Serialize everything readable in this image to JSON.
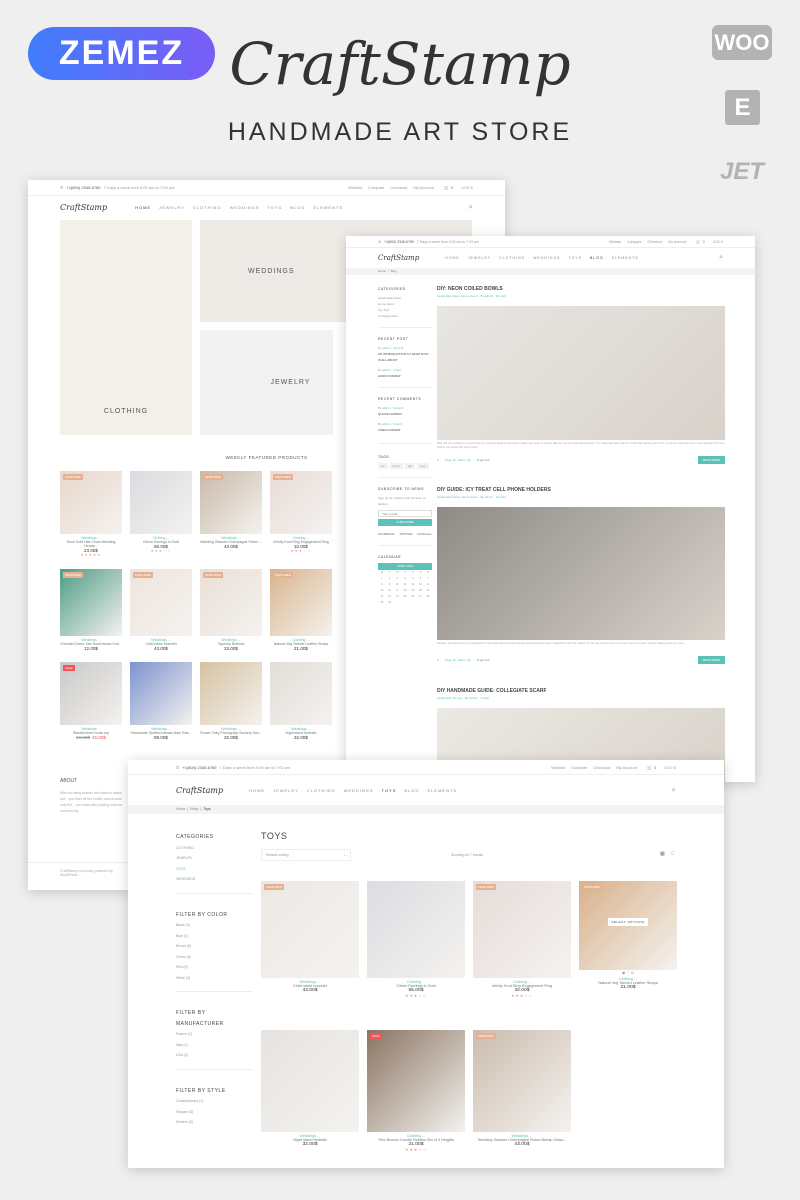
{
  "promo": {
    "vendor": "ZEMEZ",
    "title": "CraftStamp",
    "tagline": "HANDMADE ART STORE",
    "badges": [
      "WOO",
      "E",
      "JET"
    ]
  },
  "store": {
    "logo": "CraftStamp",
    "phone": "+1(800) 2345-6789",
    "hours": "7 Days a week from 9:00 am to 7:00 pm",
    "top_links": [
      "Wishlist",
      "Compare",
      "Checkout",
      "My Account"
    ],
    "cart_count": "0",
    "currency": "USD $",
    "menu": [
      "HOME",
      "JEWELRY",
      "CLOTHING",
      "WEDDINGS",
      "TOYS",
      "BLOG",
      "ELEMENTS"
    ]
  },
  "home": {
    "active_menu": "HOME",
    "banners": [
      "CLOTHING",
      "WEDDINGS",
      "JEWELRY"
    ],
    "featured_title": "WEEKLY FEATURED PRODUCTS",
    "products": [
      {
        "badge": "FEATURED",
        "cat": "Weddings ...",
        "name": "Rose Gold Hair Chain Wedding Headp...",
        "price": "23.00$",
        "stars": "★★★★★",
        "color": "#e9d7cc"
      },
      {
        "badge": "",
        "cat": "Clothing ...",
        "name": "Citrine Earrings in Gold",
        "price": "65.00$",
        "stars": "★★★☆☆",
        "color": "#dadbe0"
      },
      {
        "badge": "FEATURED",
        "cat": "Weddings ...",
        "name": "Wedding Glasses Champagne Flutes ...",
        "price": "43.00$",
        "stars": "",
        "color": "#c9b9a8"
      },
      {
        "badge": "FEATURED",
        "cat": "Clothing ...",
        "name": "Infinity Knot Ring Engagement Ring",
        "price": "32.00$",
        "stars": "★★★☆☆",
        "color": "#e8dcd8"
      },
      {
        "badge": "FEATURED",
        "cat": "Weddings ...",
        "name": "Emerald Green Yarn bowl leaves Knit...",
        "price": "12.00$",
        "stars": "",
        "color": "#4f9c86"
      },
      {
        "badge": "FEATURED",
        "cat": "Weddings ...",
        "name": "Child name bracelet",
        "price": "43.00$",
        "stars": "",
        "color": "#eee4dc"
      },
      {
        "badge": "FEATURED",
        "cat": "Weddings ...",
        "name": "Tapestry Bobbins",
        "price": "23.00$",
        "stars": "",
        "color": "#eadfd6"
      },
      {
        "badge": "FEATURED",
        "cat": "Clothing ...",
        "name": "Natural Veg Tanned Leather Straps",
        "price": "21.00$",
        "stars": "",
        "color": "#d9b48c"
      },
      {
        "badge": "SALE",
        "cat": "Weddings ...",
        "name": "Washed linen loose top",
        "price_old": "66.00$",
        "price": "45.00$",
        "stars": "",
        "color": "#c9c9c9"
      },
      {
        "badge": "",
        "cat": "Weddings ...",
        "name": "Handmade Stuffed Animals Ham Rab...",
        "price": "89.00$",
        "stars": "",
        "color": "#7d93cf"
      },
      {
        "badge": "",
        "cat": "Weddings ...",
        "name": "Flower Fairy Photograph Nursery Dec...",
        "price": "32.00$",
        "stars": "",
        "color": "#d6c2a0"
      },
      {
        "badge": "",
        "cat": "Weddings ...",
        "name": "Night stand bedside",
        "price": "32.00$",
        "stars": "",
        "color": "#e2ddd8"
      }
    ],
    "about_title": "ABOUT",
    "about_text": "With so many brands and fashion styles out... you filter all the clutter and choose only the... our team with picking only the most trendy...",
    "footer": "CraftStamp is proudly powered by WordPress..."
  },
  "blog": {
    "active_menu": "BLOG",
    "breadcrumb": [
      "Home",
      "Blog"
    ],
    "sidebar": {
      "categories_title": "CATEGORIES",
      "categories": [
        "Handmade Ideas",
        "Home decor",
        "Toy Tips",
        "Uncategorized"
      ],
      "recent_title": "RECENT POST",
      "recent": [
        {
          "meta": "By admin · 12 April",
          "title": "AN INTRODUCTION TO WHAT ETSY IS ALL ABOUT"
        },
        {
          "meta": "By admin · 3 April",
          "title": "AUDIO FORMAT"
        }
      ],
      "comments_title": "RECENT COMMENTS",
      "comments": [
        {
          "meta": "By admin · 12 April",
          "title": "QUOTE FORMAT"
        },
        {
          "meta": "By admin · 3 April",
          "title": "VIDEO FORMAT"
        }
      ],
      "tags_title": "TAGS",
      "tags": [
        "art",
        "decor",
        "gift",
        "toys"
      ],
      "subscribe_title": "SUBSCRIBE TO NEWS",
      "subscribe_text": "Sign up for updates with all news on fashion",
      "email_placeholder": "Your e-mail",
      "subscribe_button": "SUBSCRIBE",
      "social": [
        "FACEBOOK",
        "TWITTER",
        "GOOGLE+"
      ],
      "calendar_title": "CALENDAR",
      "calendar_month": "APRIL 2019",
      "weekdays": [
        "M",
        "T",
        "W",
        "T",
        "F",
        "S",
        "S"
      ],
      "days": [
        "1",
        "2",
        "3",
        "4",
        "5",
        "6",
        "7",
        "8",
        "9",
        "10",
        "11",
        "12",
        "13",
        "14",
        "15",
        "16",
        "17",
        "18",
        "19",
        "20",
        "21",
        "22",
        "23",
        "24",
        "25",
        "26",
        "27",
        "28",
        "29",
        "30"
      ]
    },
    "posts": [
      {
        "title": "DIY: NEON COILED BOWLS",
        "meta": "Handmade Ideas, Home decor · By admin · 12 April",
        "excerpt": "Well, this one actually is a much fewer fun one than whatever the phone holder may seem to anyone (like the one we wrote about before). The whole idea goes with the notion that making your lunch or a dinner might get much more relaxing if the bowl itself is you shows with some bright...",
        "comments": "0",
        "tags": "Tags: art, decor, gift",
        "button": "READ MORE",
        "color": "#e8e6e3"
      },
      {
        "title": "DIY GUIDE: ICY TREAT CELL PHONE HOLDERS",
        "meta": "Handmade Ideas, Home decor · By admin · 12 April",
        "excerpt": "Perhaps, the idea cornes for prelatetard for these late stored nod all subtope wakenbooksnum was a subjectful is ill in the makers. In this way, an this one is not a wax to fine our other uniqush looking cases you may...",
        "comments": "0",
        "tags": "Tags: art, decor, gift",
        "button": "READ MORE",
        "color": "#8e8a86"
      },
      {
        "title": "DIY HANDMADE GUIDE: COLLEGIATE SCARF",
        "meta": "Handmade Toy tips · By admin · 3 April",
        "color": "#ece9e4"
      }
    ]
  },
  "shop": {
    "active_menu": "TOYS",
    "breadcrumb": [
      "Home",
      "Shop",
      "Toys"
    ],
    "title": "TOYS",
    "sorting": "Default sorting",
    "results": "Showing all 7 results",
    "categories_title": "CATEGORIES",
    "categories": [
      "CLOTHING",
      "JEWELRY",
      "TOYS",
      "WEDDINGS"
    ],
    "active_category": "TOYS",
    "filters": [
      {
        "title": "FILTER BY COLOR",
        "items": [
          "Black (3)",
          "Blue (1)",
          "Brown (5)",
          "Green (5)",
          "Red (5)",
          "White (3)"
        ]
      },
      {
        "title": "FILTER BY MANUFACTURER",
        "items": [
          "France (2)",
          "Italy (4)",
          "USA (1)"
        ]
      },
      {
        "title": "FILTER BY STYLE",
        "items": [
          "Contemporary (1)",
          "Elegant (3)",
          "Modern (2)"
        ]
      }
    ],
    "hover_button": "SELECT OPTIONS",
    "products": [
      {
        "badge": "FEATURED",
        "cat": "Weddings ...",
        "name": "Child name bracelet",
        "price": "43.00$",
        "stars": "",
        "color": "#ece8e4"
      },
      {
        "badge": "",
        "cat": "Clothing ...",
        "name": "Citrine Earrings in Gold",
        "price": "65.00$",
        "stars": "★★★☆☆",
        "color": "#dcdde2"
      },
      {
        "badge": "FEATURED",
        "cat": "Clothing ...",
        "name": "Infinity Knot Ring Engagement Ring",
        "price": "32.00$",
        "stars": "★★★☆☆",
        "color": "#e7dcd9"
      },
      {
        "badge": "FEATURED",
        "cat": "Clothing ...",
        "name": "Natural Veg Tanned Leather Straps",
        "price": "21.00$",
        "stars": "",
        "color": "#d9b08a",
        "hover": true
      },
      {
        "badge": "",
        "cat": "Weddings ...",
        "name": "Night stand bedside",
        "price": "32.00$",
        "stars": "",
        "color": "#e6e3e0"
      },
      {
        "badge": "SALE",
        "cat": "Clothing ...",
        "name": "Tree Branch Candle Holders Set of 3 Heights",
        "price": "21.00$",
        "stars": "★★★☆☆",
        "color": "#8a7462"
      },
      {
        "badge": "FEATURED",
        "cat": "Weddings ...",
        "name": "Wedding Glasses Champagne Flutes Burlap Glass...",
        "price": "43.00$",
        "stars": "",
        "color": "#cbbcae"
      }
    ]
  },
  "colors": {
    "accent": "#5cc1b7",
    "featured": "#e4b293",
    "sale": "#f2545b",
    "zemez_start": "#3f7dfb",
    "zemez_end": "#7a5cf6"
  }
}
